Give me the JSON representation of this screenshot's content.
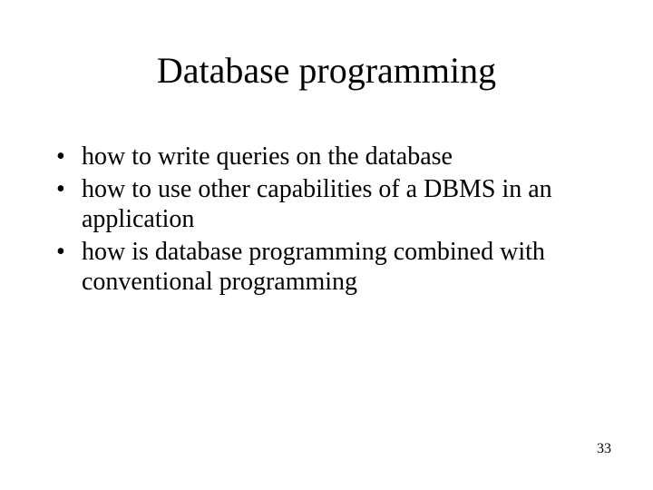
{
  "slide": {
    "title": "Database programming",
    "bullets": [
      "how to write queries on the database",
      "how to use other capabilities of a DBMS in an application",
      "how is database programming combined with conventional programming"
    ],
    "page_number": "33"
  }
}
